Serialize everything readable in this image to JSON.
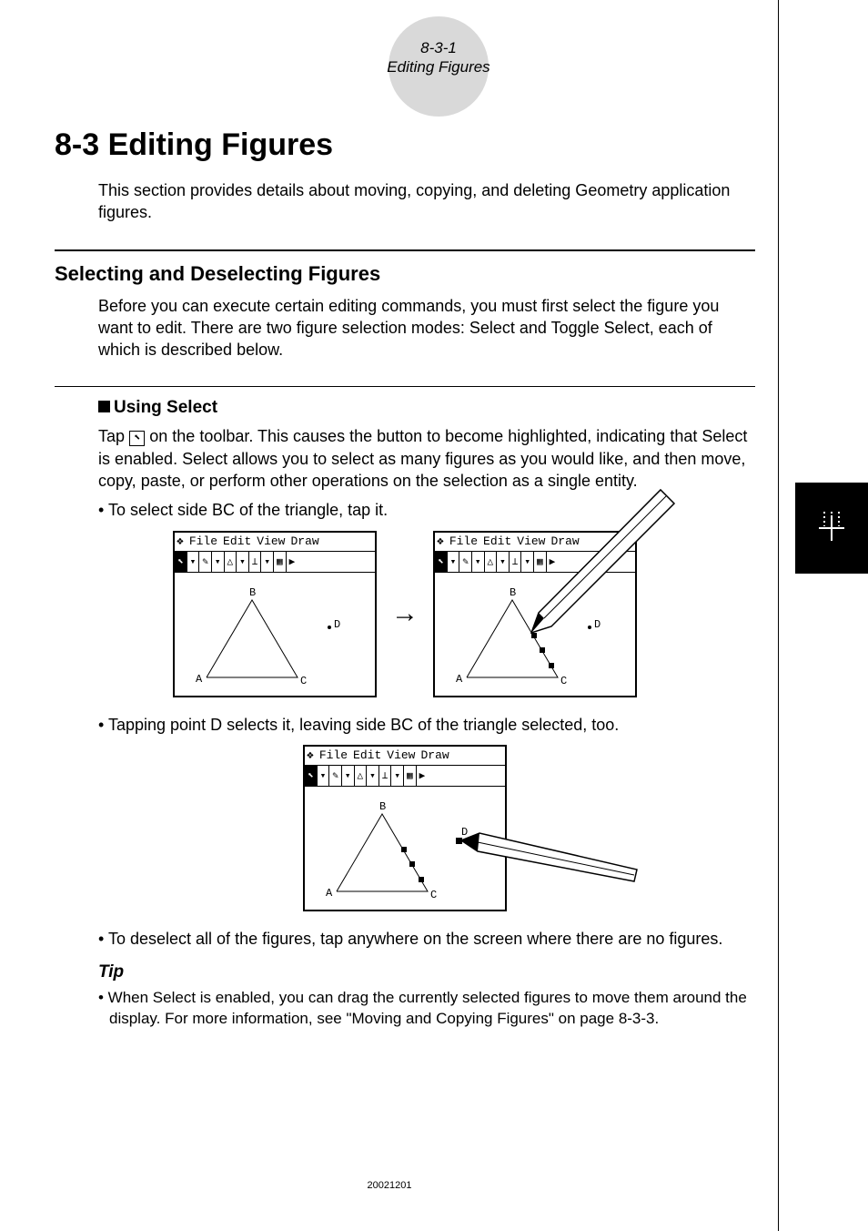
{
  "header": {
    "page_ref": "8-3-1",
    "page_title": "Editing Figures"
  },
  "h1": "8-3  Editing Figures",
  "intro": "This section provides details about moving, copying, and deleting Geometry application figures.",
  "h2": "Selecting and Deselecting Figures",
  "sec_intro": "Before you can execute certain editing commands, you must first select the figure you want to edit. There are two figure selection modes: Select and Toggle Select, each of which is described below.",
  "sub1": "Using Select",
  "sub1_body_a": "Tap ",
  "sub1_body_b": " on the toolbar. This causes the button to become highlighted, indicating that Select is enabled. Select allows you to select as many figures as you would like, and then move, copy, paste, or perform other operations on the selection as a single entity.",
  "bullets": {
    "b1": "To select side BC of the triangle, tap it.",
    "b2": "Tapping point D selects it, leaving side BC of the triangle selected, too.",
    "b3": "To deselect all of the figures, tap anywhere on the screen where there are no figures."
  },
  "calc_menu": [
    "File",
    "Edit",
    "View",
    "Draw"
  ],
  "calc_labels": {
    "A": "A",
    "B": "B",
    "C": "C",
    "D": "D"
  },
  "tip_head": "Tip",
  "tip_body": "• When Select is enabled, you can drag the currently selected figures to move them around the display. For more information, see \"Moving and Copying Figures\" on page 8-3-3.",
  "footer": "20021201"
}
